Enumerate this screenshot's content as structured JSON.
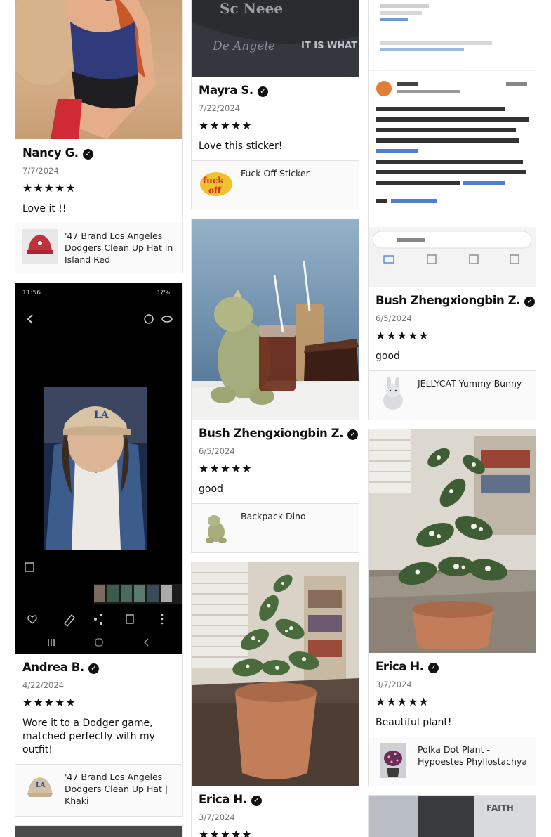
{
  "reviews": [
    {
      "name": "Nancy G.",
      "date": "7/7/2024",
      "stars": "★★★★★",
      "text": "Love it !!",
      "product": "'47 Brand Los Angeles Dodgers Clean Up Hat in Island Red"
    },
    {
      "name": "Andrea B.",
      "date": "4/22/2024",
      "stars": "★★★★★",
      "text": "Wore it to a Dodger game, matched perfectly with my outfit!",
      "product": "'47 Brand Los Angeles Dodgers Clean Up Hat | Khaki"
    },
    {
      "name": "Mayra S.",
      "date": "7/22/2024",
      "stars": "★★★★★",
      "text": "Love this sticker!",
      "product": "Fuck Off Sticker"
    },
    {
      "name": "Bush Zhengxiongbin Z.",
      "date": "6/5/2024",
      "stars": "★★★★★",
      "text": "good",
      "product": "Backpack Dino"
    },
    {
      "name": "Erica H.",
      "date": "3/7/2024",
      "stars": "★★★★★",
      "text": "",
      "product": ""
    },
    {
      "name": "Bush Zhengxiongbin Z.",
      "date": "6/5/2024",
      "stars": "★★★★★",
      "text": "good",
      "product": "JELLYCAT Yummy Bunny"
    },
    {
      "name": "Erica H.",
      "date": "3/7/2024",
      "stars": "★★★★★",
      "text": "Beautiful plant! ",
      "product": "Polka Dot Plant - Hypoestes Phyllostachya"
    }
  ],
  "verified_icon": "check-circle-icon",
  "sticker_logo_text": "fuck off"
}
